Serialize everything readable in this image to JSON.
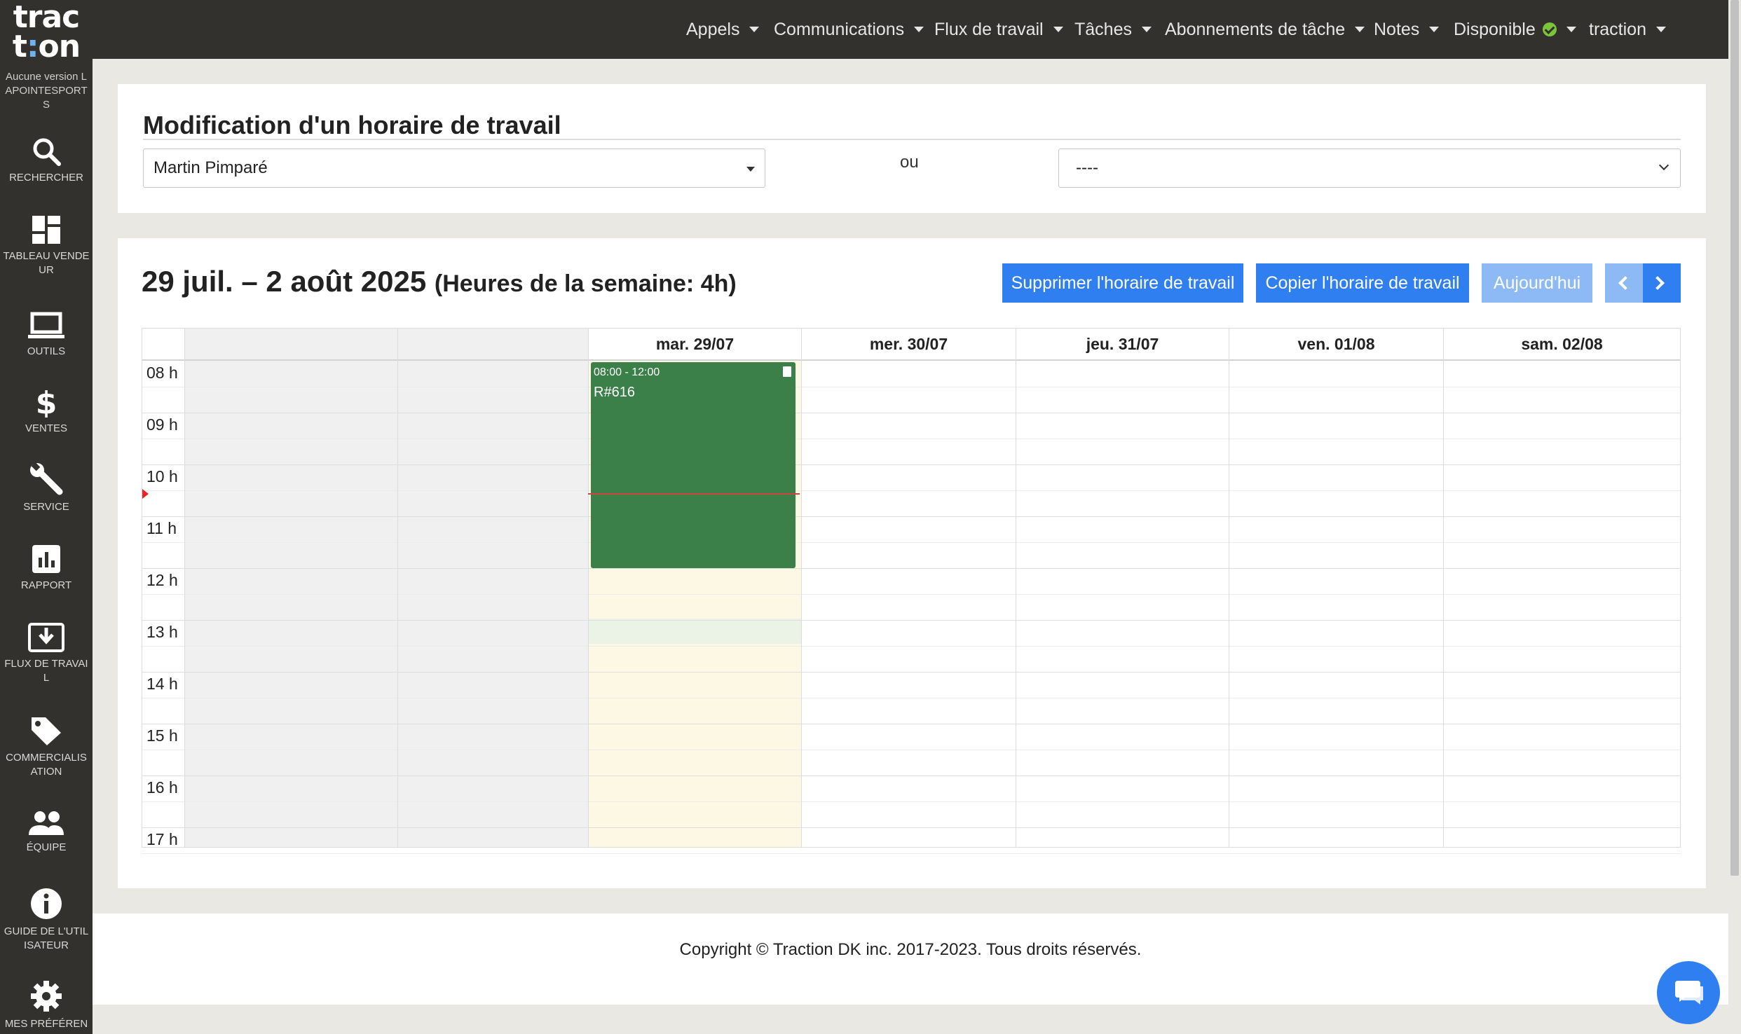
{
  "app": {
    "logo_line1": "trac",
    "logo_line2_a": "t",
    "logo_line2_b": ":",
    "logo_line2_c": "on",
    "version": "Aucune version LAPOINTESPORTS"
  },
  "sidebar": {
    "items": [
      {
        "label": "RECHERCHER",
        "icon": "search-icon"
      },
      {
        "label": "TABLEAU VENDEUR",
        "icon": "dashboard-icon"
      },
      {
        "label": "OUTILS",
        "icon": "laptop-icon"
      },
      {
        "label": "VENTES",
        "icon": "dollar-icon"
      },
      {
        "label": "SERVICE",
        "icon": "wrench-icon"
      },
      {
        "label": "RAPPORT",
        "icon": "bar-chart-icon"
      },
      {
        "label": "FLUX DE TRAVAIL",
        "icon": "download-box-icon"
      },
      {
        "label": "COMMERCIALISATION",
        "icon": "tag-icon"
      },
      {
        "label": "ÉQUIPE",
        "icon": "people-icon"
      },
      {
        "label": "GUIDE DE L'UTILISATEUR",
        "icon": "info-icon"
      },
      {
        "label": "MES PRÉFÉRENCES",
        "icon": "gear-icon"
      }
    ]
  },
  "topnav": {
    "items": [
      "Appels",
      "Communications",
      "Flux de travail",
      "Tâches",
      "Abonnements de tâche",
      "Notes",
      "Disponible",
      "traction"
    ],
    "status_color": "#7cc43a",
    "help": "?"
  },
  "editor": {
    "title": "Modification d'un horaire de travail",
    "employee_value": "Martin Pimparé",
    "or_label": "ou",
    "alt_value": "----"
  },
  "calendar": {
    "range": "29 juil. – 2 août 2025",
    "week_hours": "(Heures de la semaine: 4h)",
    "buttons": {
      "delete": "Supprimer l'horaire de travail",
      "copy": "Copier l'horaire de travail",
      "today": "Aujourd'hui"
    },
    "days": [
      "",
      "",
      "mar. 29/07",
      "mer. 30/07",
      "jeu. 31/07",
      "ven. 01/08",
      "sam. 02/08"
    ],
    "hours": [
      "08 h",
      "09 h",
      "10 h",
      "11 h",
      "12 h",
      "13 h",
      "14 h",
      "15 h",
      "16 h",
      "17 h"
    ],
    "event": {
      "time": "08:00 - 12:00",
      "name": "R#616",
      "color": "#3a8048"
    },
    "accent_color": "#2f7ff0"
  },
  "footer": {
    "copyright": "Copyright © Traction DK inc. 2017-2023. Tous droits réservés."
  }
}
